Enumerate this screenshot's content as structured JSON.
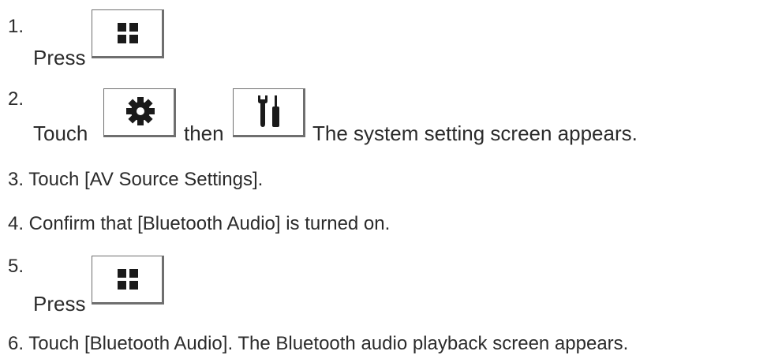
{
  "steps": [
    {
      "number": "1.",
      "word": "Press",
      "icon": "home-grid-icon"
    },
    {
      "number": "2.",
      "word": "Touch",
      "icon1": "gear-icon",
      "connector": "then",
      "icon2": "tools-icon",
      "after": "The system setting screen appears."
    },
    {
      "text": "3. Touch [AV Source Settings]."
    },
    {
      "text": "4. Confirm that [Bluetooth Audio] is turned on."
    },
    {
      "number": "5.",
      "word": "Press",
      "icon": "home-grid-icon"
    },
    {
      "text": "6. Touch [Bluetooth Audio]. The Bluetooth audio playback screen appears."
    }
  ]
}
